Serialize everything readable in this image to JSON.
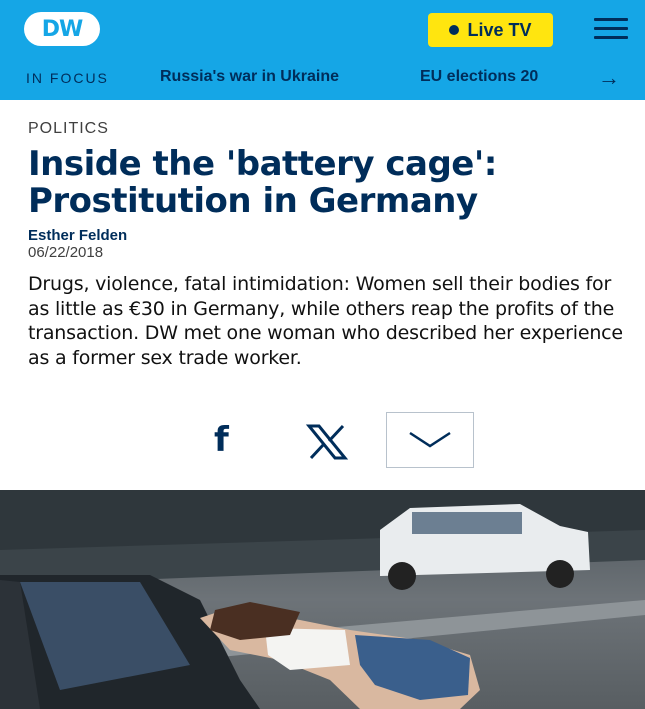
{
  "header": {
    "logo_text": "DW",
    "live_label": "Live TV",
    "menu_icon": "hamburger-menu-icon"
  },
  "nav": {
    "focus_label": "IN FOCUS",
    "links": [
      "Russia's war in Ukraine",
      "EU elections 20"
    ],
    "arrow_icon": "arrow-right-icon"
  },
  "article": {
    "kicker": "POLITICS",
    "title": "Inside the 'battery cage': Prostitution in Germany",
    "author": "Esther Felden",
    "date": "06/22/2018",
    "teaser": "Drugs, violence, fatal intimidation: Women sell their bodies for as little as €30 in Germany, while others reap the profits of the transaction. DW met one woman who described her experience as a former sex trade worker."
  },
  "share": {
    "facebook_icon": "facebook-icon",
    "x_icon": "x-icon",
    "more_icon": "chevron-down-icon"
  },
  "colors": {
    "brand_blue": "#15a6e6",
    "navy": "#002d5a",
    "live_yellow": "#ffe50f"
  }
}
